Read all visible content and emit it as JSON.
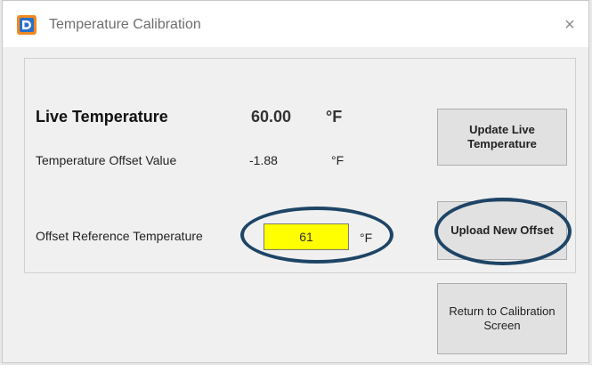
{
  "window": {
    "title": "Temperature Calibration",
    "close_glyph": "×",
    "app_icon": "app-logo-icon",
    "accent_colors": [
      "#2a6fc9",
      "#f08a24"
    ]
  },
  "live": {
    "label": "Live Temperature",
    "value": "60.00",
    "unit": "°F"
  },
  "offset": {
    "label": "Temperature Offset Value",
    "value": "-1.88",
    "unit": "°F"
  },
  "reference": {
    "label": "Offset Reference Temperature",
    "value": "61",
    "unit": "°F",
    "field_color": "#ffff00"
  },
  "buttons": {
    "update": "Update Live Temperature",
    "upload": "Upload New Offset",
    "return": "Return to Calibration Screen"
  },
  "annotation": {
    "highlight_color": "#1e4466"
  }
}
